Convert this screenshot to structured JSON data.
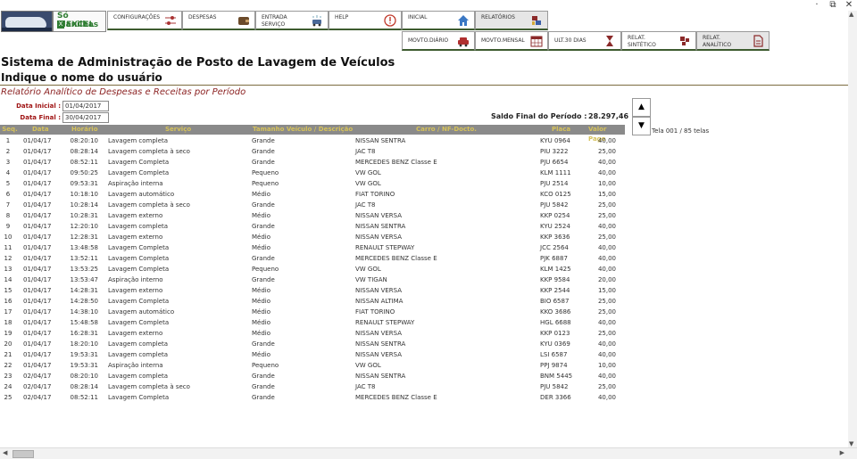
{
  "window": {
    "restore": "⧉",
    "close": "✕",
    "minimize": "·"
  },
  "brand": {
    "line1": "Só Planilhas",
    "line2": "EXCEL"
  },
  "menu_top": [
    {
      "label": "CONFIGURAÇÕES",
      "icon": "sliders-icon"
    },
    {
      "label": "DESPESAS",
      "icon": "wallet-icon"
    },
    {
      "label": "ENTRADA\nSERVIÇO",
      "icon": "car-wash-icon"
    },
    {
      "label": "HELP",
      "icon": "info-icon"
    },
    {
      "label": "INICIAL",
      "icon": "home-icon"
    },
    {
      "label": "RELATÓRIOS",
      "icon": "reports-icon"
    }
  ],
  "menu_sub": [
    {
      "label": "MOVTO.DIÁRIO",
      "icon": "car-icon"
    },
    {
      "label": "MOVTO.MENSAL",
      "icon": "calendar-icon"
    },
    {
      "label": "ULT.30 DIAS",
      "icon": "hourglass-icon"
    },
    {
      "label": "RELAT.\nSINTÉTICO",
      "icon": "puzzle-icon"
    },
    {
      "label": "RELAT.\nANALÍTICO",
      "icon": "document-icon"
    }
  ],
  "title": "Sistema de Administração de Posto de Lavagem de Veículos",
  "user_prompt": "Indique o nome do usuário",
  "report_title": "Relatório Analítico de Despesas e Receitas por Período",
  "filters": {
    "start_label": "Data Inicial :",
    "start_value": "01/04/2017",
    "end_label": "Data Final :",
    "end_value": "30/04/2017"
  },
  "saldo": {
    "label": "Saldo Final do Período :",
    "value": "28.297,46"
  },
  "pager": {
    "up": "▲",
    "down": "▼",
    "info": "Tela 001 / 85 telas"
  },
  "columns": [
    "Seq.",
    "Data",
    "Horário",
    "Serviço",
    "Tamanho Veículo / Descrição",
    "Carro / NF-Docto.",
    "Placa",
    "Valor Pago"
  ],
  "rows": [
    [
      "1",
      "01/04/17",
      "08:20:10",
      "Lavagem completa",
      "Grande",
      "NISSAN SENTRA",
      "KYU 0964",
      "40,00"
    ],
    [
      "2",
      "01/04/17",
      "08:28:14",
      "Lavagem completa à seco",
      "Grande",
      "JAC T8",
      "PIU 3222",
      "25,00"
    ],
    [
      "3",
      "01/04/17",
      "08:52:11",
      "Lavagem Completa",
      "Grande",
      "MERCEDES BENZ Classe E",
      "PJU 6654",
      "40,00"
    ],
    [
      "4",
      "01/04/17",
      "09:50:25",
      "Lavagem Completa",
      "Pequeno",
      "VW GOL",
      "KLM 1111",
      "40,00"
    ],
    [
      "5",
      "01/04/17",
      "09:53:31",
      "Aspiração interna",
      "Pequeno",
      "VW GOL",
      "PJU 2514",
      "10,00"
    ],
    [
      "6",
      "01/04/17",
      "10:18:10",
      "Lavagem automático",
      "Médio",
      "FIAT TORINO",
      "KCO 0125",
      "15,00"
    ],
    [
      "7",
      "01/04/17",
      "10:28:14",
      "Lavagem completa à seco",
      "Grande",
      "JAC T8",
      "PJU 5842",
      "25,00"
    ],
    [
      "8",
      "01/04/17",
      "10:28:31",
      "Lavagem externo",
      "Médio",
      "NISSAN VERSA",
      "KKP 0254",
      "25,00"
    ],
    [
      "9",
      "01/04/17",
      "12:20:10",
      "Lavagem completa",
      "Grande",
      "NISSAN SENTRA",
      "KYU 2524",
      "40,00"
    ],
    [
      "10",
      "01/04/17",
      "12:28:31",
      "Lavagem externo",
      "Médio",
      "NISSAN VERSA",
      "KKP 3636",
      "25,00"
    ],
    [
      "11",
      "01/04/17",
      "13:48:58",
      "Lavagem Completa",
      "Médio",
      "RENAULT STEPWAY",
      "JCC 2564",
      "40,00"
    ],
    [
      "12",
      "01/04/17",
      "13:52:11",
      "Lavagem Completa",
      "Grande",
      "MERCEDES BENZ Classe E",
      "PJK 6887",
      "40,00"
    ],
    [
      "13",
      "01/04/17",
      "13:53:25",
      "Lavagem Completa",
      "Pequeno",
      "VW GOL",
      "KLM 1425",
      "40,00"
    ],
    [
      "14",
      "01/04/17",
      "13:53:47",
      "Aspiração interno",
      "Grande",
      "VW TIGAN",
      "KKP 9584",
      "20,00"
    ],
    [
      "15",
      "01/04/17",
      "14:28:31",
      "Lavagem externo",
      "Médio",
      "NISSAN VERSA",
      "KKP 2544",
      "15,00"
    ],
    [
      "16",
      "01/04/17",
      "14:28:50",
      "Lavagem Completa",
      "Médio",
      "NISSAN ALTIMA",
      "BIO 6587",
      "25,00"
    ],
    [
      "17",
      "01/04/17",
      "14:38:10",
      "Lavagem automático",
      "Médio",
      "FIAT TORINO",
      "KKO 3686",
      "25,00"
    ],
    [
      "18",
      "01/04/17",
      "15:48:58",
      "Lavagem Completa",
      "Médio",
      "RENAULT STEPWAY",
      "HGL 6688",
      "40,00"
    ],
    [
      "19",
      "01/04/17",
      "16:28:31",
      "Lavagem externo",
      "Médio",
      "NISSAN VERSA",
      "KKP 0123",
      "25,00"
    ],
    [
      "20",
      "01/04/17",
      "18:20:10",
      "Lavagem completa",
      "Grande",
      "NISSAN SENTRA",
      "KYU 0369",
      "40,00"
    ],
    [
      "21",
      "01/04/17",
      "19:53:31",
      "Lavagem completa",
      "Médio",
      "NISSAN VERSA",
      "LSI 6587",
      "40,00"
    ],
    [
      "22",
      "01/04/17",
      "19:53:31",
      "Aspiração interna",
      "Pequeno",
      "VW GOL",
      "PPJ 9874",
      "10,00"
    ],
    [
      "23",
      "02/04/17",
      "08:20:10",
      "Lavagem completa",
      "Grande",
      "NISSAN SENTRA",
      "BNM 5445",
      "40,00"
    ],
    [
      "24",
      "02/04/17",
      "08:28:14",
      "Lavagem completa à seco",
      "Grande",
      "JAC T8",
      "PJU 5842",
      "25,00"
    ],
    [
      "25",
      "02/04/17",
      "08:52:11",
      "Lavagem Completa",
      "Grande",
      "MERCEDES BENZ Classe E",
      "DER 3366",
      "40,00"
    ]
  ]
}
